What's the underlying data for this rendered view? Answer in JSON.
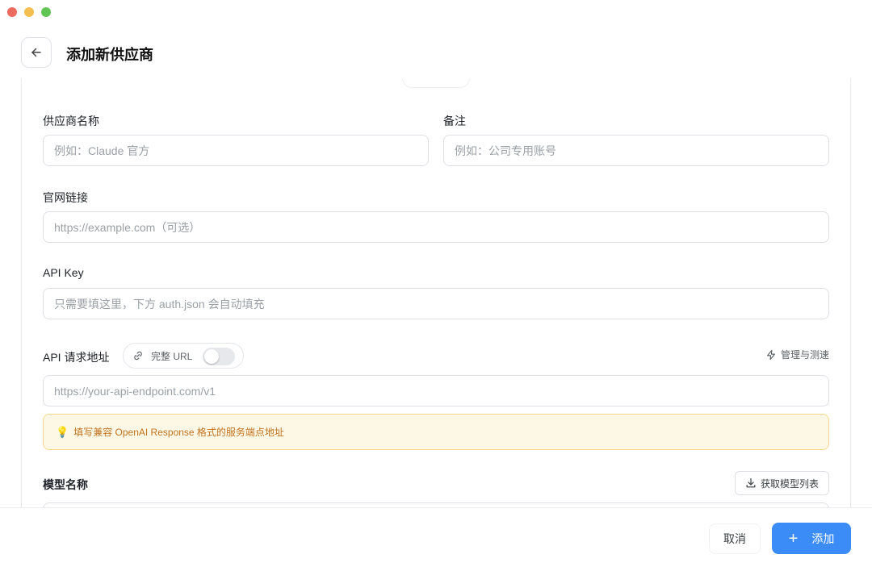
{
  "header": {
    "title": "添加新供应商"
  },
  "form": {
    "provider_name": {
      "label": "供应商名称",
      "placeholder": "例如：Claude 官方"
    },
    "notes": {
      "label": "备注",
      "placeholder": "例如：公司专用账号"
    },
    "website": {
      "label": "官网链接",
      "placeholder": "https://example.com（可选）"
    },
    "api_key": {
      "label": "API Key",
      "placeholder": "只需要填这里，下方 auth.json 会自动填充"
    },
    "api_url": {
      "label": "API 请求地址",
      "full_url_toggle_label": "完整 URL",
      "full_url_toggle_on": false,
      "manage_link": "管理与测速",
      "placeholder": "https://your-api-endpoint.com/v1",
      "tip": "填写兼容 OpenAI Response 格式的服务端点地址"
    },
    "model_name": {
      "label": "模型名称",
      "fetch_button": "获取模型列表"
    }
  },
  "footer": {
    "cancel_label": "取消",
    "add_label": "添加"
  },
  "colors": {
    "accent": "#3b8cf6",
    "tip_bg": "#fdf8e6",
    "tip_border": "#f5d98a",
    "tip_text": "#c0731f"
  }
}
